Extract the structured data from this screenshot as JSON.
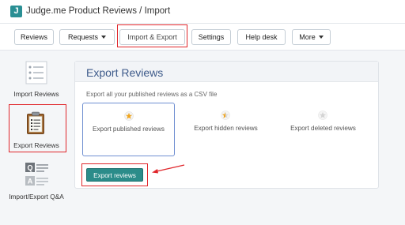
{
  "app": {
    "logo_letter": "J",
    "title": "Judge.me Product Reviews / Import"
  },
  "nav": {
    "reviews": "Reviews",
    "requests": "Requests",
    "import_export": "Import & Export",
    "settings": "Settings",
    "help_desk": "Help desk",
    "more": "More"
  },
  "sidebar": {
    "items": [
      {
        "label": "Import Reviews",
        "icon": "list-icon"
      },
      {
        "label": "Export Reviews",
        "icon": "clipboard-icon"
      },
      {
        "label": "Import/Export Q&A",
        "icon": "qa-icon"
      }
    ]
  },
  "panel": {
    "title": "Export Reviews",
    "subtitle": "Export all your published reviews as a CSV file",
    "options": [
      {
        "label": "Export published reviews",
        "icon": "star-gold-icon",
        "selected": true
      },
      {
        "label": "Export hidden reviews",
        "icon": "star-half-icon",
        "selected": false
      },
      {
        "label": "Export deleted reviews",
        "icon": "star-grey-icon",
        "selected": false
      }
    ],
    "export_button": "Export reviews"
  },
  "colors": {
    "highlight": "#e0262b",
    "accent": "#2b8c8a",
    "title_blue": "#3d5a8a"
  }
}
